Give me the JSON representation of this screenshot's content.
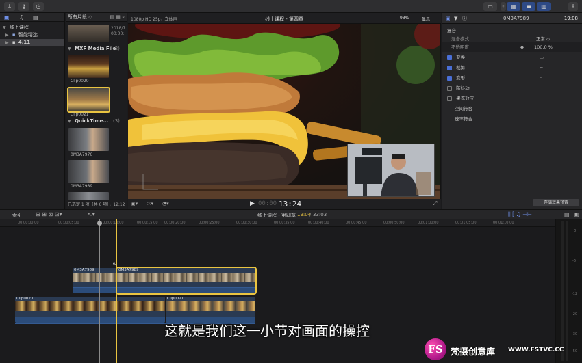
{
  "toolbar": {
    "import_icon": "download-icon",
    "keywords_icon": "key-icon",
    "background_tasks_icon": "clock-icon",
    "share_icon": "share-icon"
  },
  "libraries": {
    "items": [
      {
        "label": "线上课程",
        "expanded": true
      },
      {
        "label": "智能精选",
        "expanded": false
      },
      {
        "label": "4.11",
        "selected": true
      }
    ]
  },
  "browser": {
    "filter_label": "所有片段",
    "clip_top_date": "2018/7",
    "clip_top_time": "00:00:",
    "groups": [
      {
        "name": "MXF Media File",
        "count": "(2)"
      },
      {
        "name": "QuickTime...",
        "count": "(3)"
      }
    ],
    "clips": [
      {
        "name": "Clip0020"
      },
      {
        "name": "Clip0021",
        "selected": true
      },
      {
        "name": "0M3A7976"
      },
      {
        "name": "0M3A7989"
      }
    ],
    "status": "已选定 1 项（共 6 项），12:12"
  },
  "viewer": {
    "format": "1080p HD 25p，立体声",
    "title": "线上课程 - 第四章",
    "zoom": "93%",
    "display_label": "显示",
    "timecode": "13:24"
  },
  "inspector": {
    "clip_name": "0M3A7989",
    "duration": "19:08",
    "compositing_label": "复合",
    "blend_mode_label": "混合模式",
    "blend_mode_value": "正常 ◇",
    "opacity_label": "不透明度",
    "opacity_value": "100.0 %",
    "sections": [
      {
        "label": "变换",
        "enabled": true
      },
      {
        "label": "裁剪",
        "enabled": true
      },
      {
        "label": "变形",
        "enabled": true
      },
      {
        "label": "防抖动",
        "enabled": false
      },
      {
        "label": "果冻效应",
        "enabled": false
      },
      {
        "label": "空间符合",
        "enabled": null
      },
      {
        "label": "速率符合",
        "enabled": null
      }
    ],
    "save_preset_label": "存储效果预置"
  },
  "timeline": {
    "index_label": "索引",
    "title": "线上课程 - 第四章",
    "position": "19:04",
    "total": "33:03",
    "ruler": [
      "00:00:00:00",
      "00:00:05:00",
      "00:00:10:00",
      "00:00:15:00",
      "00:00:20:00",
      "00:00:25:00",
      "00:00:30:00",
      "00:00:35:00",
      "00:00:40:00",
      "00:00:45:00",
      "00:00:50:00",
      "00:01:00:00",
      "00:01:05:00",
      "00:01:10:00"
    ],
    "clips": [
      {
        "name": "0M3A7989"
      },
      {
        "name": "0M3A7989",
        "selected": true
      },
      {
        "name": "Clip0020"
      },
      {
        "name": "Clip0021"
      }
    ],
    "meter_levels": [
      "0",
      "-6",
      "-12",
      "-20",
      "-30",
      "-50"
    ]
  },
  "overlay": {
    "subtitle": "这就是我们这一小节对画面的操控",
    "watermark_logo": "FS",
    "watermark_text": "梵摄创意库",
    "watermark_url": "WWW.FSTVC.CC"
  },
  "colors": {
    "accent_blue": "#4a6fd6",
    "selection_yellow": "#e9c441",
    "playhead": "#e9c441"
  }
}
